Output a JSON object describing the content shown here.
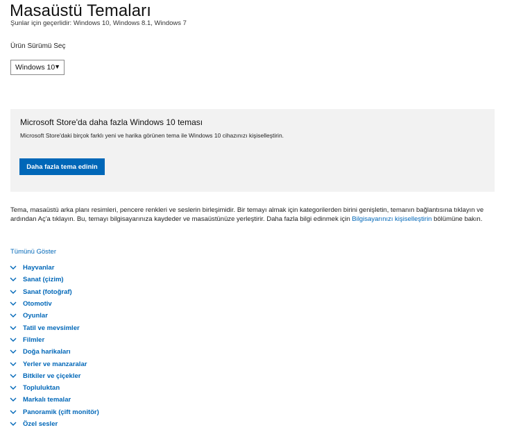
{
  "header": {
    "title": "Masaüstü Temaları",
    "applies_to": "Şunlar için geçerlidir: Windows 10, Windows 8.1, Windows 7"
  },
  "product": {
    "label": "Ürün Sürümü Seç",
    "selected": "Windows 10",
    "caret": "▼"
  },
  "promo": {
    "title": "Microsoft Store'da daha fazla Windows 10 teması",
    "description": "Microsoft Store'daki birçok farklı yeni ve harika görünen tema ile Windows 10 cihazınızı kişiselleştirin.",
    "button_label": "Daha fazla tema edinin",
    "button_color": "#0067b8"
  },
  "intro": {
    "text_before_link": "Tema, masaüstü arka planı resimleri, pencere renkleri ve seslerin birleşimidir. Bir temayı almak için kategorilerden birini genişletin, temanın bağlantısına tıklayın ve ardından Aç'a tıklayın. Bu, temayı bilgisayarınıza kaydeder ve masaüstünüze yerleştirir. Daha fazla bilgi edinmek için ",
    "link_text": "Bilgisayarınızı kişiselleştirin",
    "text_after_link": " bölümüne bakın."
  },
  "categories": {
    "show_all": "Tümünü Göster",
    "chevron_icon": "chevron-down-icon",
    "accent_color": "#0067b8",
    "items": [
      "Hayvanlar",
      "Sanat (çizim)",
      "Sanat (fotoğraf)",
      "Otomotiv",
      "Oyunlar",
      "Tatil ve mevsimler",
      "Filmler",
      "Doğa harikaları",
      "Yerler ve manzaralar",
      "Bitkiler ve çiçekler",
      "Topluluktan",
      "Markalı temalar",
      "Panoramik (çift monitör)",
      "Özel sesler"
    ]
  }
}
